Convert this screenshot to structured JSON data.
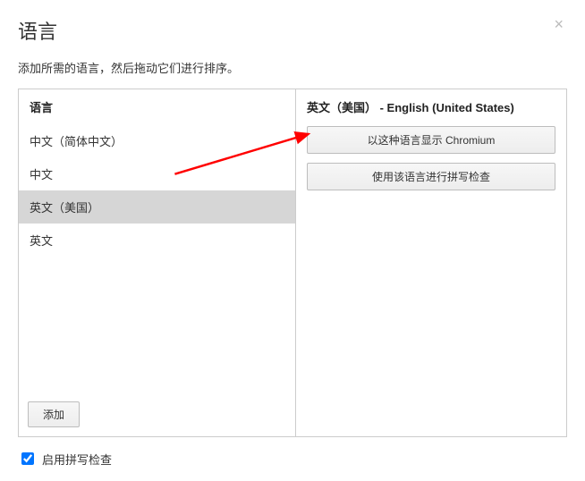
{
  "dialog": {
    "title": "语言",
    "close_glyph": "×",
    "subtitle": "添加所需的语言，然后拖动它们进行排序。"
  },
  "left_panel": {
    "header": "语言",
    "items": [
      {
        "label": "中文（简体中文）",
        "selected": false
      },
      {
        "label": "中文",
        "selected": false
      },
      {
        "label": "英文（美国）",
        "selected": true
      },
      {
        "label": "英文",
        "selected": false
      }
    ],
    "add_button": "添加"
  },
  "right_panel": {
    "header": "英文（美国） - English (United States)",
    "display_button": "以这种语言显示 Chromium",
    "spellcheck_button": "使用该语言进行拼写检查"
  },
  "footer": {
    "spellcheck_checkbox_label": "启用拼写检查",
    "spellcheck_checked": true
  },
  "annotation": {
    "arrow_color": "#ff0000"
  }
}
